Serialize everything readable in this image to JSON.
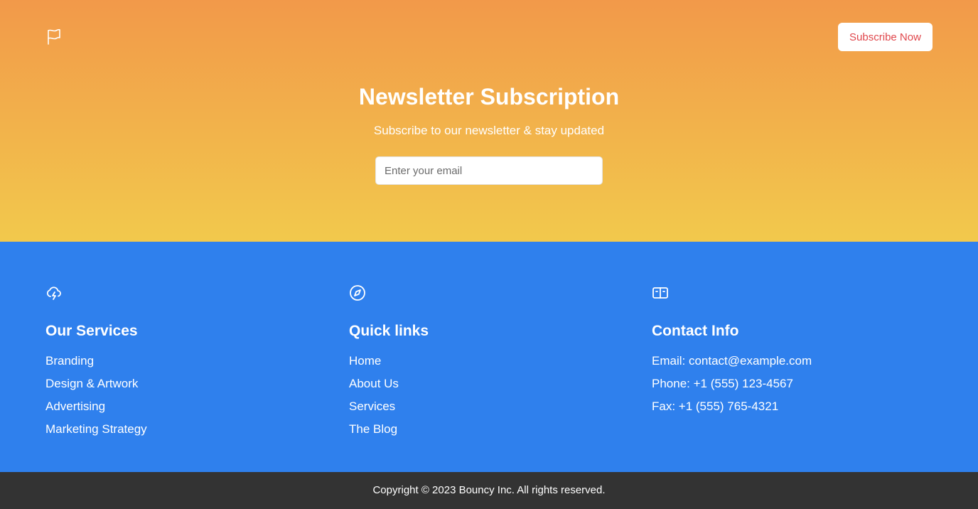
{
  "header": {
    "logo_icon": "flag-icon",
    "cta_label": "Subscribe Now",
    "cta_color": "#E0474C"
  },
  "hero": {
    "title": "Newsletter Subscription",
    "subtitle": "Subscribe to our newsletter & stay updated",
    "email_placeholder": "Enter your email",
    "email_value": "",
    "gradient_top": "#F2994A",
    "gradient_bottom": "#F2C94C"
  },
  "footer": {
    "background": "#2F80ED",
    "columns": [
      {
        "icon": "cloud-lightning-icon",
        "title": "Our Services",
        "items": [
          "Branding",
          "Design & Artwork",
          "Advertising",
          "Marketing Strategy"
        ]
      },
      {
        "icon": "compass-icon",
        "title": "Quick links",
        "items": [
          "Home",
          "About Us",
          "Services",
          "The Blog"
        ]
      },
      {
        "icon": "wallet-icon",
        "title": "Contact Info",
        "items": [
          "Email: contact@example.com",
          "Phone: +1 (555) 123-4567",
          "Fax: +1 (555) 765-4321"
        ]
      }
    ]
  },
  "copyright": {
    "text": "Copyright © 2023 Bouncy Inc. All rights reserved.",
    "background": "#333333"
  }
}
